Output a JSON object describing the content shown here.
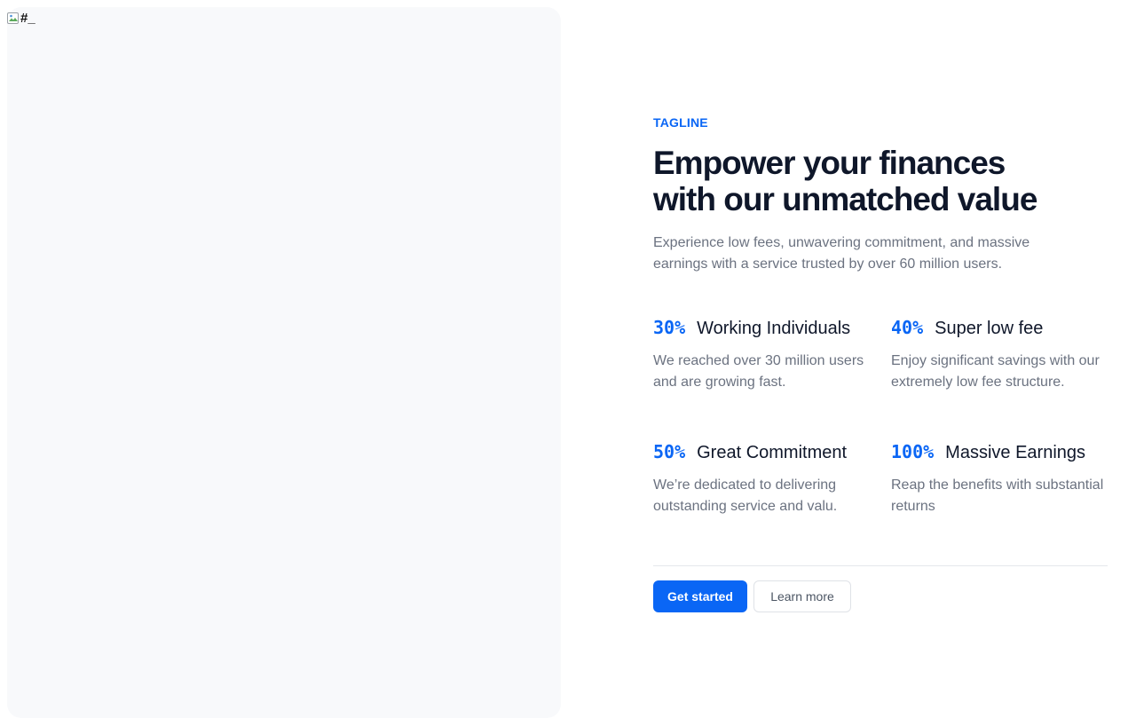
{
  "image": {
    "alt_text": "#_"
  },
  "hero": {
    "tagline": "TAGLINE",
    "headline_line1": "Empower your finances",
    "headline_line2": "with our unmatched value",
    "subtitle": "Experience low fees, unwavering commitment, and massive earnings with a service trusted by over 60 million users."
  },
  "stats": [
    {
      "percent": "30%",
      "title": "Working Individuals",
      "description": "We reached over 30 million users and are growing fast."
    },
    {
      "percent": "40%",
      "title": "Super low fee",
      "description": "Enjoy significant savings with our extremely low fee structure."
    },
    {
      "percent": "50%",
      "title": "Great Commitment",
      "description": "We’re dedicated to delivering outstanding service and valu."
    },
    {
      "percent": "100%",
      "title": "Massive Earnings",
      "description": "Reap the benefits with substantial returns"
    }
  ],
  "actions": {
    "primary_label": "Get started",
    "secondary_label": "Learn more"
  },
  "colors": {
    "accent": "#0a66f5",
    "heading": "#0f172a",
    "muted_text": "#6b7280",
    "image_panel_bg": "#f8f9fb",
    "divider": "#e5e7eb"
  },
  "icons": {
    "broken_image": "broken-image-icon"
  }
}
